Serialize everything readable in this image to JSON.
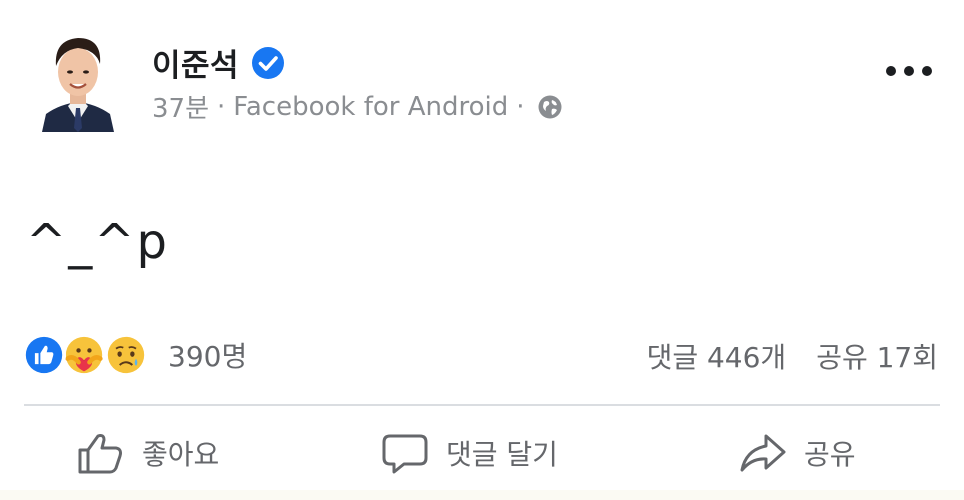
{
  "post": {
    "author": {
      "name": "이준석",
      "verified": true,
      "avatar_icon": "profile-photo"
    },
    "meta": {
      "time": "37분",
      "source": "Facebook for Android",
      "separator": "·",
      "audience_icon": "globe-icon"
    },
    "more_icon": "more-horizontal-icon",
    "text": "^_^p",
    "reactions": {
      "icons": [
        "like-reaction-icon",
        "care-reaction-icon",
        "sad-reaction-icon"
      ],
      "count": "390명"
    },
    "stats": {
      "comments": "댓글 446개",
      "shares": "공유 17회"
    },
    "actions": {
      "like": "좋아요",
      "comment": "댓글 달기",
      "share": "공유"
    },
    "colors": {
      "verified_blue": "#1877f2",
      "like_blue": "#1877f2",
      "reaction_yellow": "#f7c33b",
      "secondary_text": "#65676b"
    }
  }
}
